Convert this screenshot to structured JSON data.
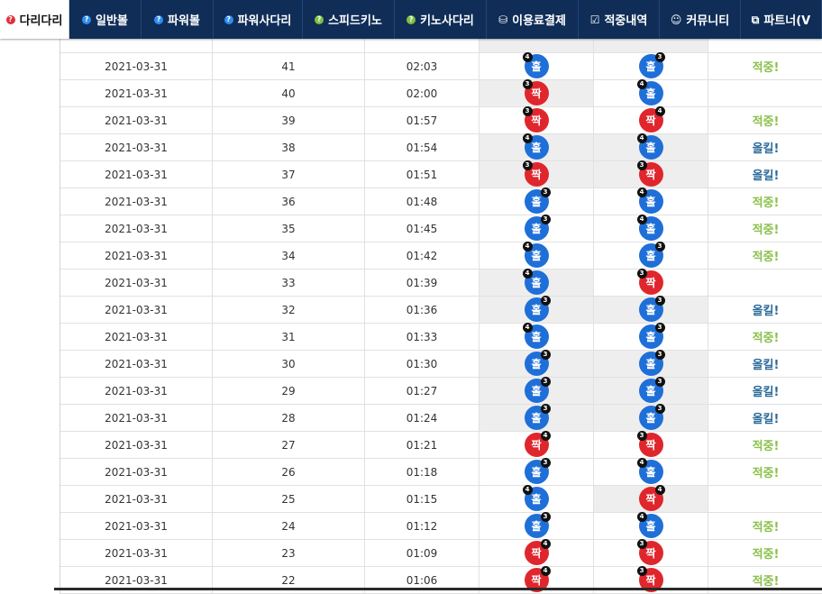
{
  "nav": [
    {
      "label": "다리다리",
      "icon": "question-circle-icon",
      "icon_glyph": "?",
      "icon_style": "q-red",
      "active": true,
      "width": 77
    },
    {
      "label": "일반볼",
      "icon": "question-circle-icon",
      "icon_glyph": "?",
      "icon_style": "q-blue",
      "active": false,
      "width": 80
    },
    {
      "label": "파워볼",
      "icon": "question-circle-icon",
      "icon_glyph": "?",
      "icon_style": "q-blue",
      "active": false,
      "width": 80
    },
    {
      "label": "파워사다리",
      "icon": "question-circle-icon",
      "icon_glyph": "?",
      "icon_style": "q-blue",
      "active": false,
      "width": 99
    },
    {
      "label": "스피드키노",
      "icon": "question-circle-icon",
      "icon_glyph": "?",
      "icon_style": "q-green",
      "active": false,
      "width": 102
    },
    {
      "label": "키노사다리",
      "icon": "question-circle-icon",
      "icon_glyph": "?",
      "icon_style": "q-green",
      "active": false,
      "width": 102
    },
    {
      "label": "이용료결제",
      "icon": "database-icon",
      "icon_glyph": "⛁",
      "icon_style": "glyph",
      "active": false,
      "width": 102
    },
    {
      "label": "적중내역",
      "icon": "check-square-icon",
      "icon_glyph": "☑",
      "icon_style": "glyph",
      "active": false,
      "width": 90
    },
    {
      "label": "커뮤니티",
      "icon": "smile-icon",
      "icon_glyph": "☺",
      "icon_style": "glyph",
      "active": false,
      "width": 90
    },
    {
      "label": "파트너(V",
      "icon": "cubes-icon",
      "icon_glyph": "⧉",
      "icon_style": "glyph",
      "active": false,
      "width": 90
    }
  ],
  "colors": {
    "blue": "#1f6fd8",
    "red": "#e0262d",
    "hit": "#8ac04a",
    "up": "#2b6a99",
    "nav": "#0f2d57"
  },
  "rows": [
    {
      "date": "2021-03-31",
      "round": "41",
      "time": "02:03",
      "b1": {
        "text": "홀",
        "color": "blue",
        "num": "4",
        "pos": "left"
      },
      "b1_miss": false,
      "b2": {
        "text": "홀",
        "color": "blue",
        "num": "3",
        "pos": "right"
      },
      "b2_miss": false,
      "result": "적중!",
      "result_type": "hit"
    },
    {
      "date": "2021-03-31",
      "round": "40",
      "time": "02:00",
      "b1": {
        "text": "짝",
        "color": "red",
        "num": "3",
        "pos": "left"
      },
      "b1_miss": true,
      "b2": {
        "text": "홀",
        "color": "blue",
        "num": "4",
        "pos": "left"
      },
      "b2_miss": false,
      "result": "",
      "result_type": "none"
    },
    {
      "date": "2021-03-31",
      "round": "39",
      "time": "01:57",
      "b1": {
        "text": "짝",
        "color": "red",
        "num": "3",
        "pos": "left"
      },
      "b1_miss": false,
      "b2": {
        "text": "짝",
        "color": "red",
        "num": "4",
        "pos": "right"
      },
      "b2_miss": false,
      "result": "적중!",
      "result_type": "hit"
    },
    {
      "date": "2021-03-31",
      "round": "38",
      "time": "01:54",
      "b1": {
        "text": "홀",
        "color": "blue",
        "num": "4",
        "pos": "left"
      },
      "b1_miss": true,
      "b2": {
        "text": "홀",
        "color": "blue",
        "num": "4",
        "pos": "left"
      },
      "b2_miss": true,
      "result": "올킬!",
      "result_type": "up"
    },
    {
      "date": "2021-03-31",
      "round": "37",
      "time": "01:51",
      "b1": {
        "text": "짝",
        "color": "red",
        "num": "3",
        "pos": "left"
      },
      "b1_miss": true,
      "b2": {
        "text": "짝",
        "color": "red",
        "num": "3",
        "pos": "left"
      },
      "b2_miss": true,
      "result": "올킬!",
      "result_type": "up"
    },
    {
      "date": "2021-03-31",
      "round": "36",
      "time": "01:48",
      "b1": {
        "text": "홀",
        "color": "blue",
        "num": "3",
        "pos": "right"
      },
      "b1_miss": false,
      "b2": {
        "text": "홀",
        "color": "blue",
        "num": "4",
        "pos": "left"
      },
      "b2_miss": false,
      "result": "적중!",
      "result_type": "hit"
    },
    {
      "date": "2021-03-31",
      "round": "35",
      "time": "01:45",
      "b1": {
        "text": "홀",
        "color": "blue",
        "num": "3",
        "pos": "right"
      },
      "b1_miss": false,
      "b2": {
        "text": "홀",
        "color": "blue",
        "num": "4",
        "pos": "left"
      },
      "b2_miss": false,
      "result": "적중!",
      "result_type": "hit"
    },
    {
      "date": "2021-03-31",
      "round": "34",
      "time": "01:42",
      "b1": {
        "text": "홀",
        "color": "blue",
        "num": "4",
        "pos": "left"
      },
      "b1_miss": false,
      "b2": {
        "text": "홀",
        "color": "blue",
        "num": "3",
        "pos": "right"
      },
      "b2_miss": false,
      "result": "적중!",
      "result_type": "hit"
    },
    {
      "date": "2021-03-31",
      "round": "33",
      "time": "01:39",
      "b1": {
        "text": "홀",
        "color": "blue",
        "num": "4",
        "pos": "left"
      },
      "b1_miss": true,
      "b2": {
        "text": "짝",
        "color": "red",
        "num": "3",
        "pos": "left"
      },
      "b2_miss": false,
      "result": "",
      "result_type": "none"
    },
    {
      "date": "2021-03-31",
      "round": "32",
      "time": "01:36",
      "b1": {
        "text": "홀",
        "color": "blue",
        "num": "3",
        "pos": "right"
      },
      "b1_miss": true,
      "b2": {
        "text": "홀",
        "color": "blue",
        "num": "3",
        "pos": "right"
      },
      "b2_miss": true,
      "result": "올킬!",
      "result_type": "up"
    },
    {
      "date": "2021-03-31",
      "round": "31",
      "time": "01:33",
      "b1": {
        "text": "홀",
        "color": "blue",
        "num": "4",
        "pos": "left"
      },
      "b1_miss": false,
      "b2": {
        "text": "홀",
        "color": "blue",
        "num": "3",
        "pos": "right"
      },
      "b2_miss": false,
      "result": "적중!",
      "result_type": "hit"
    },
    {
      "date": "2021-03-31",
      "round": "30",
      "time": "01:30",
      "b1": {
        "text": "홀",
        "color": "blue",
        "num": "3",
        "pos": "right"
      },
      "b1_miss": true,
      "b2": {
        "text": "홀",
        "color": "blue",
        "num": "3",
        "pos": "right"
      },
      "b2_miss": true,
      "result": "올킬!",
      "result_type": "up"
    },
    {
      "date": "2021-03-31",
      "round": "29",
      "time": "01:27",
      "b1": {
        "text": "홀",
        "color": "blue",
        "num": "3",
        "pos": "right"
      },
      "b1_miss": true,
      "b2": {
        "text": "홀",
        "color": "blue",
        "num": "3",
        "pos": "right"
      },
      "b2_miss": true,
      "result": "올킬!",
      "result_type": "up"
    },
    {
      "date": "2021-03-31",
      "round": "28",
      "time": "01:24",
      "b1": {
        "text": "홀",
        "color": "blue",
        "num": "3",
        "pos": "right"
      },
      "b1_miss": true,
      "b2": {
        "text": "홀",
        "color": "blue",
        "num": "3",
        "pos": "right"
      },
      "b2_miss": true,
      "result": "올킬!",
      "result_type": "up"
    },
    {
      "date": "2021-03-31",
      "round": "27",
      "time": "01:21",
      "b1": {
        "text": "짝",
        "color": "red",
        "num": "4",
        "pos": "right"
      },
      "b1_miss": false,
      "b2": {
        "text": "짝",
        "color": "red",
        "num": "3",
        "pos": "left"
      },
      "b2_miss": false,
      "result": "적중!",
      "result_type": "hit"
    },
    {
      "date": "2021-03-31",
      "round": "26",
      "time": "01:18",
      "b1": {
        "text": "홀",
        "color": "blue",
        "num": "3",
        "pos": "right"
      },
      "b1_miss": false,
      "b2": {
        "text": "홀",
        "color": "blue",
        "num": "4",
        "pos": "left"
      },
      "b2_miss": false,
      "result": "적중!",
      "result_type": "hit"
    },
    {
      "date": "2021-03-31",
      "round": "25",
      "time": "01:15",
      "b1": {
        "text": "홀",
        "color": "blue",
        "num": "4",
        "pos": "left"
      },
      "b1_miss": false,
      "b2": {
        "text": "짝",
        "color": "red",
        "num": "4",
        "pos": "right"
      },
      "b2_miss": true,
      "result": "",
      "result_type": "none"
    },
    {
      "date": "2021-03-31",
      "round": "24",
      "time": "01:12",
      "b1": {
        "text": "홀",
        "color": "blue",
        "num": "3",
        "pos": "right"
      },
      "b1_miss": false,
      "b2": {
        "text": "홀",
        "color": "blue",
        "num": "4",
        "pos": "left"
      },
      "b2_miss": false,
      "result": "적중!",
      "result_type": "hit"
    },
    {
      "date": "2021-03-31",
      "round": "23",
      "time": "01:09",
      "b1": {
        "text": "짝",
        "color": "red",
        "num": "4",
        "pos": "right"
      },
      "b1_miss": false,
      "b2": {
        "text": "짝",
        "color": "red",
        "num": "3",
        "pos": "left"
      },
      "b2_miss": false,
      "result": "적중!",
      "result_type": "hit"
    },
    {
      "date": "2021-03-31",
      "round": "22",
      "time": "01:06",
      "b1": {
        "text": "짝",
        "color": "red",
        "num": "4",
        "pos": "right"
      },
      "b1_miss": false,
      "b2": {
        "text": "짝",
        "color": "red",
        "num": "3",
        "pos": "left"
      },
      "b2_miss": false,
      "result": "적중!",
      "result_type": "hit"
    }
  ]
}
